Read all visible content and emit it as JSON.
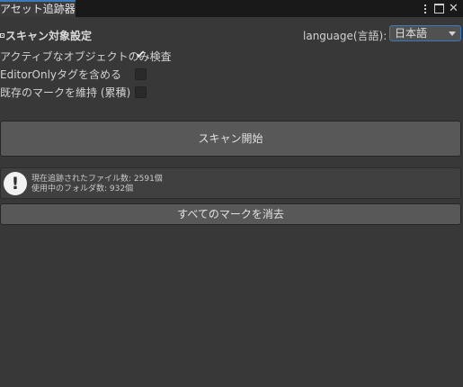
{
  "window": {
    "tab_title": "アセット追跡器",
    "tools": [
      "kebab-menu-icon",
      "maximize-icon",
      "close-icon"
    ]
  },
  "header": {
    "section_title": "スキャン対象設定",
    "language_label": "language(言語):",
    "language_value": "日本語"
  },
  "toggles": [
    {
      "label": "アクティブなオブジェクトのみ検査",
      "checked": true
    },
    {
      "label": "EditorOnlyタグを含める",
      "checked": false
    },
    {
      "label": "既存のマークを維持 (累積)",
      "checked": false
    }
  ],
  "actions": {
    "scan_label": "スキャン開始",
    "clear_label": "すべてのマークを消去"
  },
  "status": {
    "icon": "info-icon",
    "line1": "現在追跡されたファイル数: 2591個",
    "line2": "使用中のフォルダ数: 932個"
  },
  "colors": {
    "background": "#383838",
    "accent": "#3a79bb",
    "button": "#585858"
  }
}
